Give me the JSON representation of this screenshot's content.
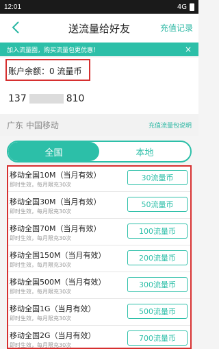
{
  "status": {
    "time": "12:01",
    "network": "4G"
  },
  "nav": {
    "title": "送流量给好友",
    "record_label": "充值记录"
  },
  "notice": {
    "text": "加入流量圈，购买流量包更优惠！",
    "close": "×"
  },
  "balance": {
    "text": "账户余额：0 流量币"
  },
  "phone": {
    "prefix": "137",
    "suffix": "810"
  },
  "carrier": {
    "name": "广东 中国移动",
    "help": "充值流量包说明"
  },
  "tabs": [
    {
      "label": "全国"
    },
    {
      "label": "本地"
    }
  ],
  "items": [
    {
      "name": "移动全国10M（当月有效）",
      "sub": "即时生效，每月限充30次",
      "price": "30流量币"
    },
    {
      "name": "移动全国30M（当月有效）",
      "sub": "即时生效，每月限充30次",
      "price": "50流量币"
    },
    {
      "name": "移动全国70M（当月有效）",
      "sub": "即时生效，每月限充30次",
      "price": "100流量币"
    },
    {
      "name": "移动全国150M（当月有效）",
      "sub": "即时生效，每月限充30次",
      "price": "200流量币"
    },
    {
      "name": "移动全国500M（当月有效）",
      "sub": "即时生效，每月限充30次",
      "price": "300流量币"
    },
    {
      "name": "移动全国1G（当月有效）",
      "sub": "即时生效，每月限充30次",
      "price": "500流量币"
    },
    {
      "name": "移动全国2G（当月有效）",
      "sub": "即时生效，每月限充30次",
      "price": "700流量币"
    }
  ],
  "colors": {
    "accent": "#2cbfa8",
    "highlight": "#d62f2f"
  }
}
